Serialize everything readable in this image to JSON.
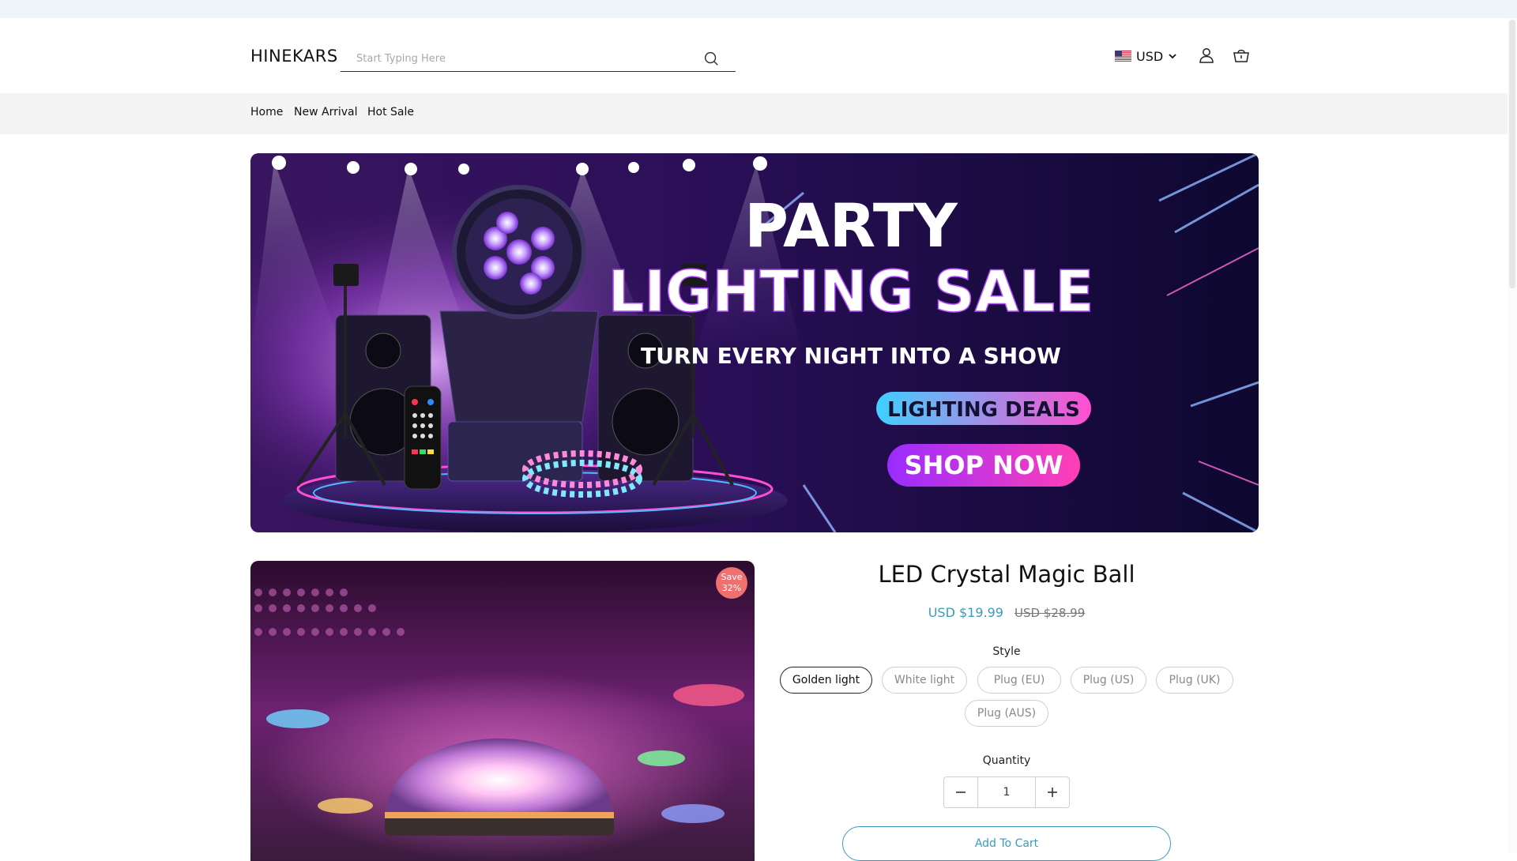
{
  "header": {
    "logo": "HINEKARS",
    "search_placeholder": "Start Typing Here",
    "currency": "USD"
  },
  "nav": {
    "items": [
      "Home",
      "New Arrival",
      "Hot Sale"
    ]
  },
  "banner": {
    "headline_line1": "PARTY",
    "headline_line2": "LIGHTING SALE",
    "subtitle": "TURN EVERY NIGHT INTO A SHOW",
    "deals_label": "LIGHTING DEALS",
    "cta": "SHOP NOW"
  },
  "product": {
    "title": "LED Crystal Magic Ball",
    "price": "USD $19.99",
    "compare_price": "USD $28.99",
    "save_badge_line1": "Save",
    "save_badge_line2": "32%",
    "style_label": "Style",
    "styles": [
      "Golden light",
      "White light",
      "Plug (EU)",
      "Plug (US)",
      "Plug (UK)",
      "Plug (AUS)"
    ],
    "selected_style": "Golden light",
    "quantity_label": "Quantity",
    "quantity": "1",
    "add_to_cart": "Add To Cart"
  },
  "colors": {
    "accent": "#3b9ab8",
    "badge": "#f0706f",
    "nav_bg": "#f4f4f5",
    "top_strip": "#eef5fb"
  },
  "icons": [
    "search-icon",
    "us-flag-icon",
    "chevron-down-icon",
    "user-icon",
    "cart-icon",
    "minus-icon",
    "plus-icon"
  ]
}
